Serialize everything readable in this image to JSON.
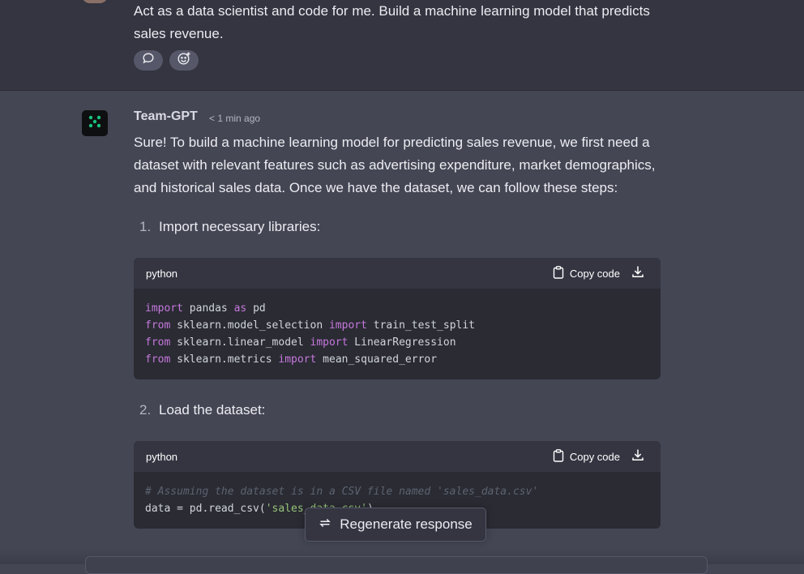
{
  "user_message": {
    "text": "Act as a data scientist and code for me. Build a machine learning model that predicts sales revenue."
  },
  "assistant": {
    "name": "Team-GPT",
    "timestamp": "< 1 min ago",
    "intro": "Sure! To build a machine learning model for predicting sales revenue, we first need a dataset with relevant features such as advertising expenditure, market demographics, and historical sales data. Once we have the dataset, we can follow these steps:",
    "steps": [
      {
        "num": "1.",
        "text": "Import necessary libraries:"
      },
      {
        "num": "2.",
        "text": "Load the dataset:"
      }
    ]
  },
  "code_blocks": [
    {
      "lang": "python",
      "copy_label": "Copy code"
    },
    {
      "lang": "python",
      "copy_label": "Copy code"
    }
  ],
  "code1": {
    "l1": [
      "import",
      " pandas ",
      "as",
      " pd"
    ],
    "l2": [
      "from",
      " sklearn.model_selection ",
      "import",
      " train_test_split"
    ],
    "l3": [
      "from",
      " sklearn.linear_model ",
      "import",
      " LinearRegression"
    ],
    "l4": [
      "from",
      " sklearn.metrics ",
      "import",
      " mean_squared_error"
    ]
  },
  "code2": {
    "comment": "# Assuming the dataset is in a CSV file named 'sales_data.csv'",
    "line2_a": "data = pd.read_csv(",
    "line2_str": "'sales_data.csv'",
    "line2_b": ")"
  },
  "regenerate_label": "Regenerate response",
  "colors": {
    "keyword": "#c678dd",
    "string": "#98c379",
    "comment": "#5c6370",
    "assistant_icon": "#19c37d"
  }
}
